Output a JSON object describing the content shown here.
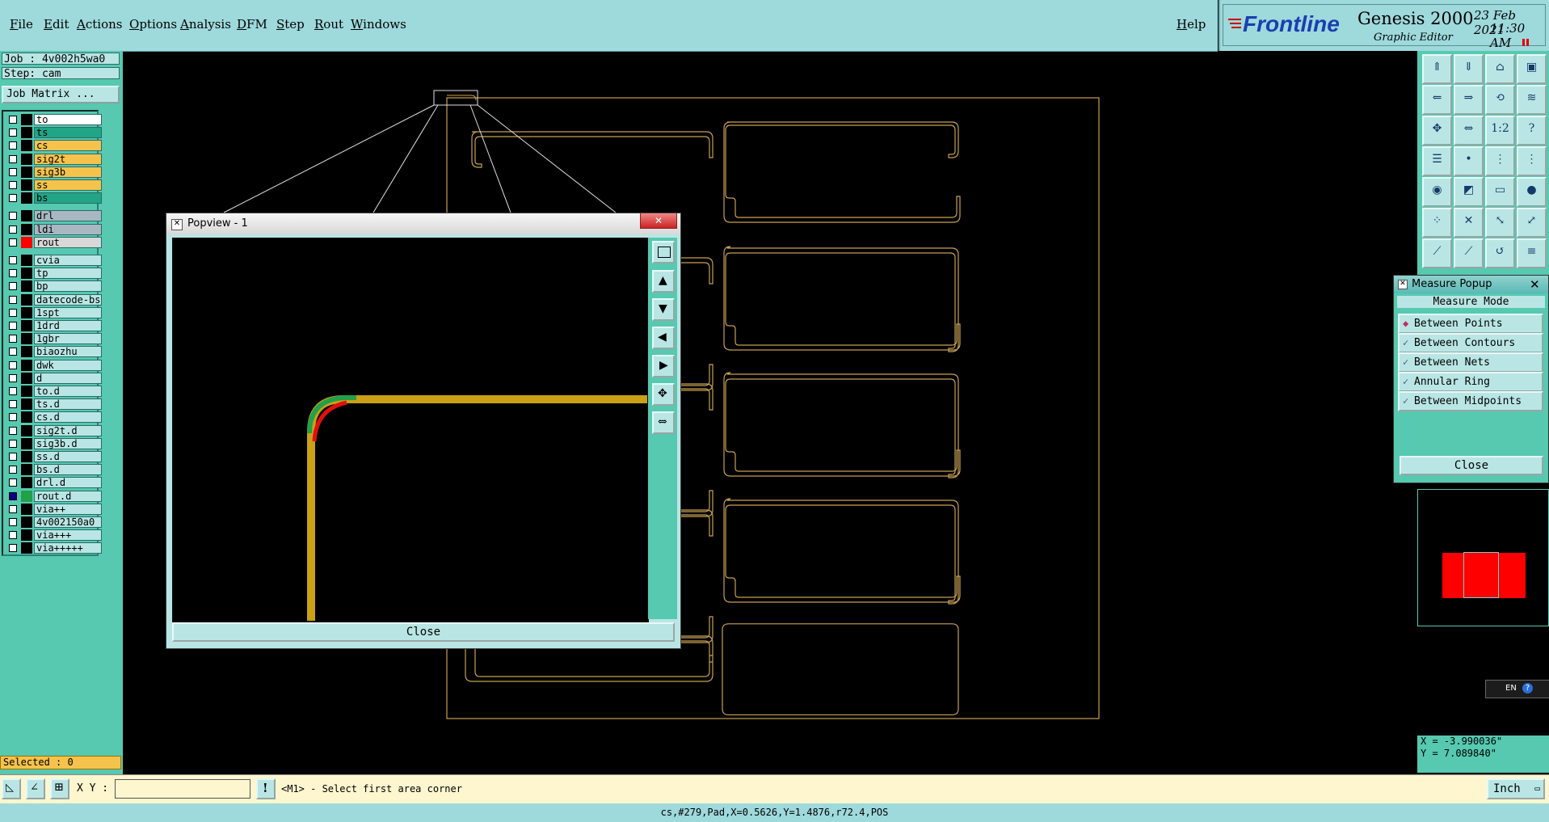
{
  "menu": [
    "File",
    "Edit",
    "Actions",
    "Options",
    "Analysis",
    "DFM",
    "Step",
    "Rout",
    "Windows"
  ],
  "help": "Help",
  "brand": {
    "logo": "Frontline",
    "product": "Genesis 2000",
    "subtitle": "Graphic Editor",
    "date": "23 Feb 2021",
    "time": "11:30 AM"
  },
  "job": {
    "job_label": "Job : 4v002h5wa0",
    "step_label": "Step: cam",
    "matrix_button": "Job Matrix ..."
  },
  "layers": [
    {
      "name": "to",
      "color": "#ffffff"
    },
    {
      "name": "ts",
      "color": "#22a585"
    },
    {
      "name": "cs",
      "color": "#f5c34c"
    },
    {
      "name": "sig2t",
      "color": "#f5c34c"
    },
    {
      "name": "sig3b",
      "color": "#f5c34c"
    },
    {
      "name": "ss",
      "color": "#f5c34c"
    },
    {
      "name": "bs",
      "color": "#22a585"
    },
    {
      "name": "drl",
      "color": "#a9b7c2"
    },
    {
      "name": "ldi",
      "color": "#a9b7c2"
    },
    {
      "name": "rout",
      "color": "#d8d8d8"
    },
    {
      "name": "cvia",
      "color": "#b9e6e4"
    },
    {
      "name": "tp",
      "color": "#b9e6e4"
    },
    {
      "name": "bp",
      "color": "#b9e6e4"
    },
    {
      "name": "datecode-bs",
      "color": "#b9e6e4"
    },
    {
      "name": "1spt",
      "color": "#b9e6e4"
    },
    {
      "name": "1drd",
      "color": "#b9e6e4"
    },
    {
      "name": "1gbr",
      "color": "#b9e6e4"
    },
    {
      "name": "biaozhu",
      "color": "#b9e6e4"
    },
    {
      "name": "dwk",
      "color": "#b9e6e4"
    },
    {
      "name": "d",
      "color": "#b9e6e4"
    },
    {
      "name": "to.d",
      "color": "#b9e6e4"
    },
    {
      "name": "ts.d",
      "color": "#b9e6e4"
    },
    {
      "name": "cs.d",
      "color": "#b9e6e4"
    },
    {
      "name": "sig2t.d",
      "color": "#b9e6e4"
    },
    {
      "name": "sig3b.d",
      "color": "#b9e6e4"
    },
    {
      "name": "ss.d",
      "color": "#b9e6e4"
    },
    {
      "name": "bs.d",
      "color": "#b9e6e4"
    },
    {
      "name": "drl.d",
      "color": "#b9e6e4"
    },
    {
      "name": "rout.d",
      "color": "#b9e6e4"
    },
    {
      "name": "via++",
      "color": "#b9e6e4"
    },
    {
      "name": "4v002150a0",
      "color": "#b9e6e4"
    },
    {
      "name": "via+++",
      "color": "#b9e6e4"
    },
    {
      "name": "via+++++",
      "color": "#b9e6e4"
    }
  ],
  "selected": "Selected : 0",
  "popview": {
    "title": "Popview - 1",
    "close": "Close"
  },
  "measure": {
    "title": "Measure Popup",
    "mode_label": "Measure Mode",
    "options": [
      "Between Points",
      "Between Contours",
      "Between Nets",
      "Annular Ring",
      "Between Midpoints"
    ],
    "close": "Close"
  },
  "coords": {
    "x": "X = -3.990036\"",
    "y": "Y = 7.089840\""
  },
  "bottom": {
    "xy_label": "X Y :",
    "xy_value": "",
    "prompt": "<M1> - Select first area corner",
    "units": "Inch"
  },
  "status": "cs,#279,Pad,X=0.5626,Y=1.4876,r72.4,POS",
  "ime": "EN",
  "colors": {
    "teal": "#56c9b0",
    "light": "#b9e6e4",
    "outline": "#c7a052",
    "trace": "#c9a016"
  }
}
